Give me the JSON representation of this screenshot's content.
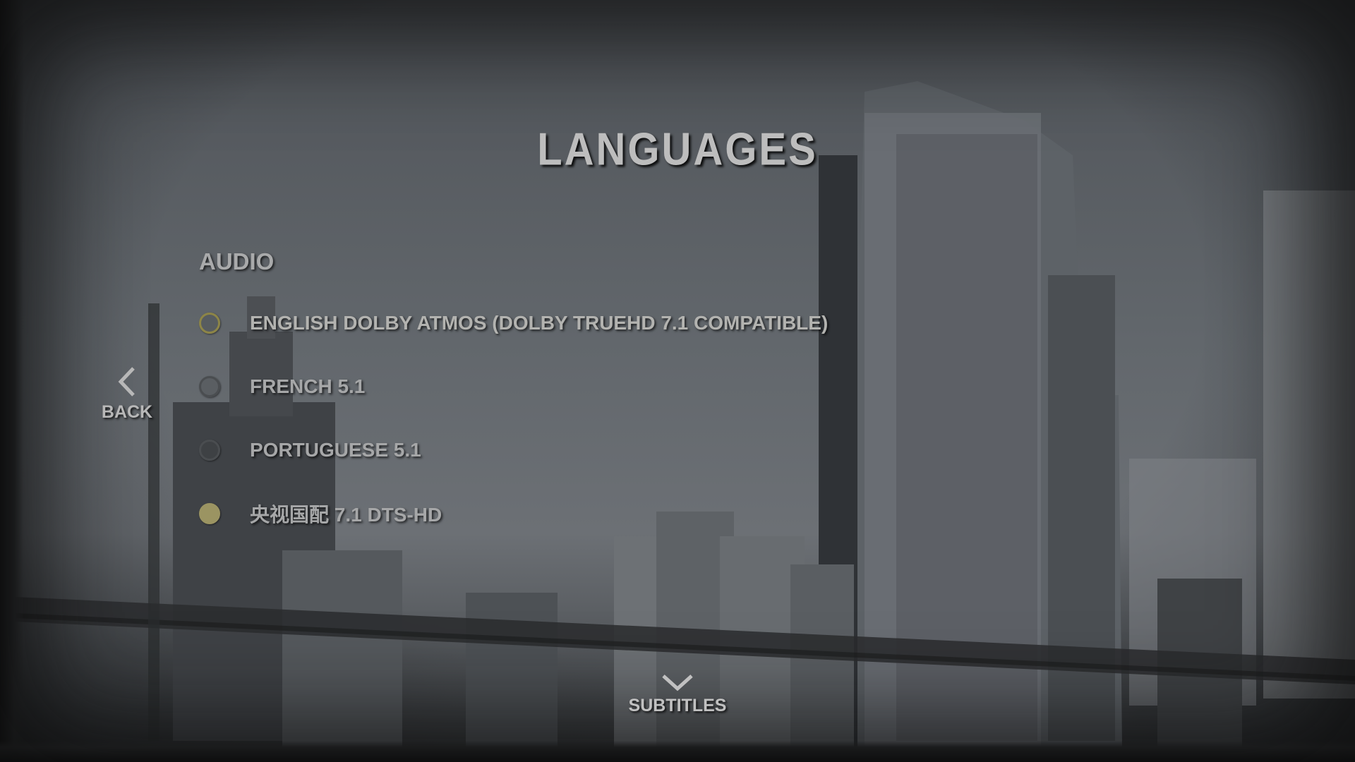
{
  "menu": {
    "title": "LANGUAGES",
    "section_label": "AUDIO"
  },
  "audio_options": [
    {
      "label": "ENGLISH DOLBY ATMOS (DOLBY TRUEHD 7.1 COMPATIBLE)",
      "state": "focused"
    },
    {
      "label": "FRENCH 5.1",
      "state": "unselected"
    },
    {
      "label": "PORTUGUESE 5.1",
      "state": "unselected"
    },
    {
      "label": "央视国配 7.1 DTS-HD",
      "state": "selected"
    }
  ],
  "navigation": {
    "back_label": "BACK",
    "back_icon": "chevron-left-icon",
    "subtitles_label": "SUBTITLES",
    "subtitles_icon": "chevron-down-icon"
  },
  "colors": {
    "title_text": "#bdbdbd",
    "option_text": "#a6a7a8",
    "radio_focus": "#8d8547",
    "radio_selected": "#9b9462"
  }
}
